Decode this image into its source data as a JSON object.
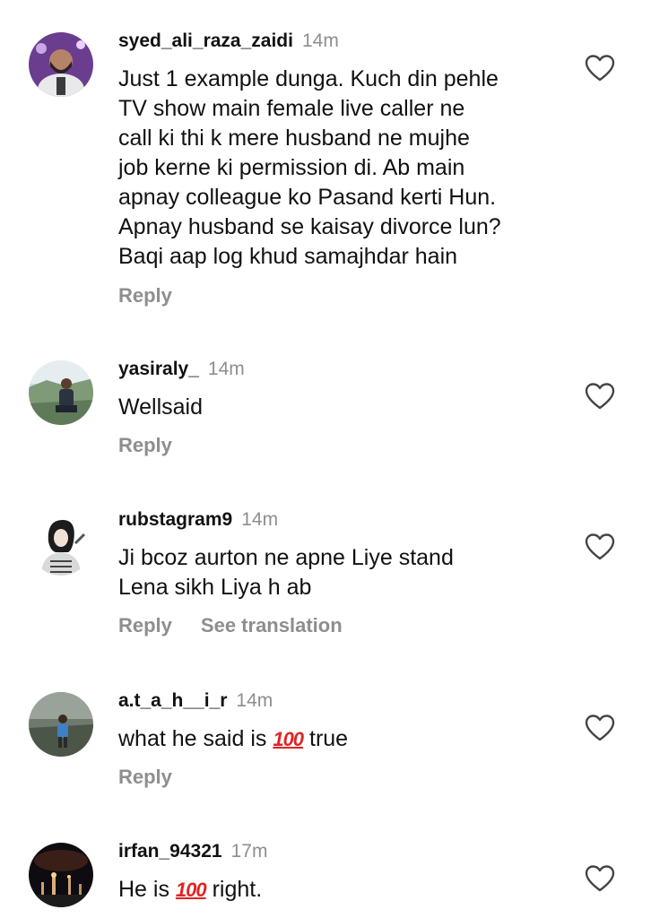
{
  "comments": [
    {
      "username": "syed_ali_raza_zaidi",
      "time": "14m",
      "lines": [
        "Just 1 example dunga. Kuch din pehle",
        "TV show main female live caller ne",
        "call ki thi k mere husband ne mujhe",
        "job kerne ki permission di. Ab main",
        "apnay colleague ko Pasand kerti Hun.",
        "Apnay husband se kaisay divorce lun?",
        "Baqi aap log khud samajhdar hain"
      ],
      "reply": "Reply"
    },
    {
      "username": "yasiraly_",
      "time": "14m",
      "lines": [
        "Wellsaid"
      ],
      "reply": "Reply"
    },
    {
      "username": "rubstagram9",
      "time": "14m",
      "lines": [
        "Ji bcoz aurton ne apne Liye stand",
        "Lena sikh Liya h ab"
      ],
      "reply": "Reply",
      "translation": "See translation"
    },
    {
      "username": "a.t_a_h__i_r",
      "time": "14m",
      "text_before": "what he said is ",
      "emoji": "100",
      "text_after": " true",
      "reply": "Reply"
    },
    {
      "username": "irfan_94321",
      "time": "17m",
      "text_before": "He is ",
      "emoji": "100",
      "text_after": " right."
    }
  ],
  "icons": {
    "like": "heart-outline-icon",
    "emoji": "hundred-points-emoji"
  },
  "colors": {
    "emoji_red": "#e02424",
    "muted": "#8e8e8e"
  }
}
